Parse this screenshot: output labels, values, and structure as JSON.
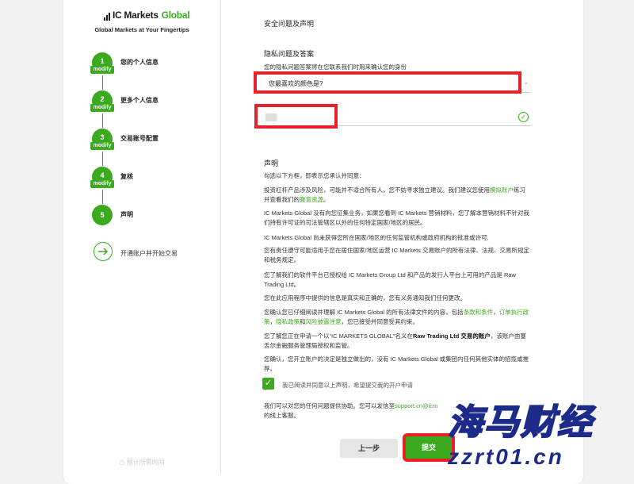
{
  "brand": {
    "logo_prefix": "IC Markets",
    "logo_name": "Global",
    "tagline": "Global Markets at Your Fingertips"
  },
  "steps": [
    {
      "num": "1",
      "label": "您的个人信息",
      "badge": "modify"
    },
    {
      "num": "2",
      "label": "更多个人信息",
      "badge": "modify"
    },
    {
      "num": "3",
      "label": "交易账号配置",
      "badge": "modify"
    },
    {
      "num": "4",
      "label": "复核",
      "badge": "modify"
    },
    {
      "num": "5",
      "label": "声明"
    }
  ],
  "open_account_label": "开通账户并开始交易",
  "bottom_note": "预计所需时间",
  "security_title": "安全问题及声明",
  "privacy": {
    "title": "隐私问题及答案",
    "desc": "您的隐私问题答案将在您联系我们时用来确认您的身份",
    "question_value": "您最喜欢的颜色是?"
  },
  "declaration": {
    "title": "声明",
    "intro": "勾选以下方框，即表示您承认并同意：",
    "p1_a": "投资杠杆产品涉及风险，可能并不适合所有人，您不妨寻求独立建议。我们建议您使用",
    "p1_link1": "模拟账户",
    "p1_b": "练习并查看我们的",
    "p1_link2": "教育资源",
    "p1_c": "。",
    "p2": "IC Markets Global 没有向您征集业务，如果您看到 IC Markets 营销材料，您了解本营销材料不针对我们持有许可证的司法管辖区以外的任何特定国家/地区的居民。",
    "p3": "IC Markets Global 尚未获得您所在国家/地区的任何监管机构或政府机构的批准或许可.",
    "p4": "您有责任遵守可能适用于您在居住国家/地区运营 IC Markets 交易账户的所有法律、法规、交易所规定和税务规定。",
    "p5": "您了解我们的软件平台已授权给 IC Markets Group Ltd 和产品的发行人平台上可用的产品是 Raw Trading Ltd。",
    "p6": "您在此应用程序中提供的信息是真实和正确的，您有义务通知我们任何更改。",
    "p7_a": "您确认您已仔细阅读并理解 IC Markets Global 的所有法律文件的内容，包括",
    "p7_link1": "条款和条件",
    "p7_b": "，",
    "p7_link2": "订单执行政策",
    "p7_c": "，",
    "p7_link3": "隐私政策",
    "p7_d": "和",
    "p7_link4": "风险披露注意",
    "p7_e": "，您已接受并同意受其约束。",
    "p8_a": "您了解您正在申请一个以“IC MARKETS GLOBAL”名义在",
    "p8_bold": "Raw Trading Ltd 交易的账户",
    "p8_b": "，该账户由塞舌尔金融服务管理局授权和监管。",
    "p9": "您确认，您开立账户的决定是独立做出的，没有 IC Markets Global 或集团内任何其他实体的招揽或推荐。",
    "checkbox_label": "我已阅读并同意以上声明，希望提交我的开户申请",
    "contact_a": "我们可以对您的任何问题提供协助。您可以发信至",
    "contact_email": "support.cn@icm",
    "contact_b": "的线上客服。"
  },
  "buttons": {
    "prev": "上一步",
    "submit": "提交"
  },
  "watermark": {
    "cn": "海马财经",
    "url": "zzrt01.cn"
  },
  "colors": {
    "accent": "#3caa1e",
    "highlight": "#e8202a",
    "watermark": "#1c2b8a"
  }
}
